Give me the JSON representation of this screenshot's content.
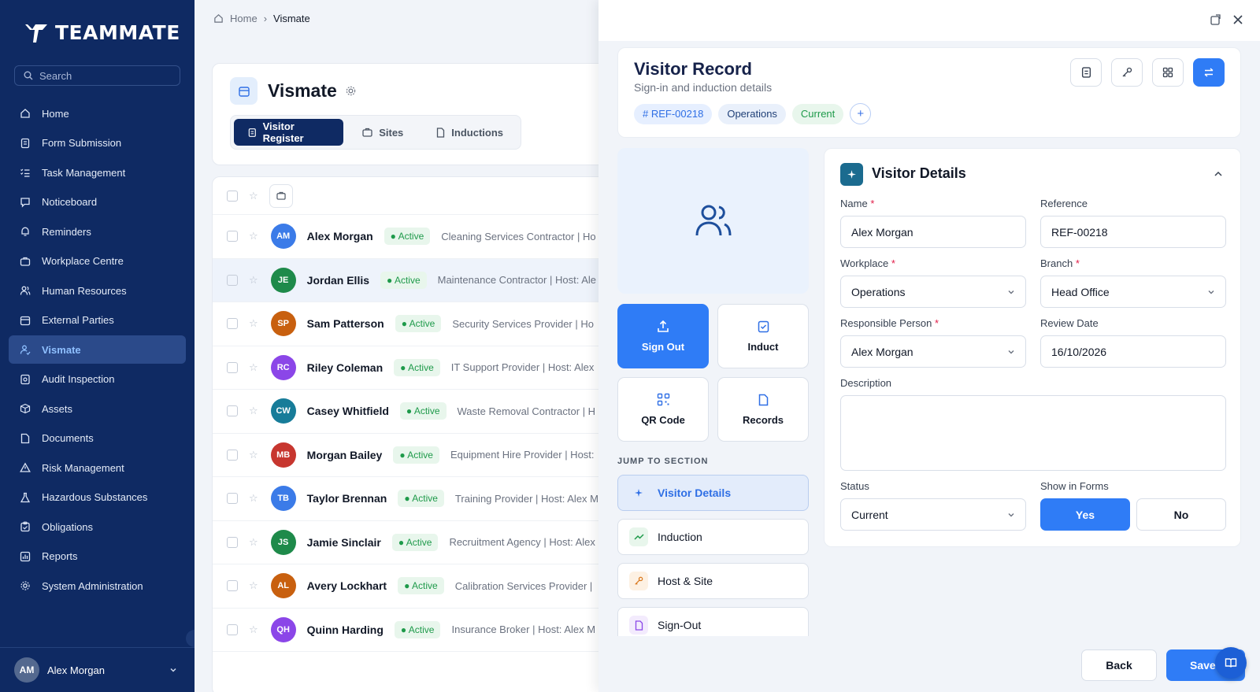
{
  "app": {
    "brand": "TEAMMATE",
    "search_placeholder": "Search"
  },
  "sidebar": {
    "items": [
      {
        "label": "Home",
        "icon": "home-icon"
      },
      {
        "label": "Form Submission",
        "icon": "form-icon"
      },
      {
        "label": "Task Management",
        "icon": "task-list-icon"
      },
      {
        "label": "Noticeboard",
        "icon": "noticeboard-icon"
      },
      {
        "label": "Reminders",
        "icon": "bell-icon"
      },
      {
        "label": "Workplace Centre",
        "icon": "briefcase-icon"
      },
      {
        "label": "Human Resources",
        "icon": "people-icon"
      },
      {
        "label": "External Parties",
        "icon": "calendar-icon"
      },
      {
        "label": "Vismate",
        "icon": "user-check-icon"
      },
      {
        "label": "Audit Inspection",
        "icon": "audit-icon"
      },
      {
        "label": "Assets",
        "icon": "box-icon"
      },
      {
        "label": "Documents",
        "icon": "document-icon"
      },
      {
        "label": "Risk Management",
        "icon": "warning-icon"
      },
      {
        "label": "Hazardous Substances",
        "icon": "flask-icon"
      },
      {
        "label": "Obligations",
        "icon": "clipboard-icon"
      },
      {
        "label": "Reports",
        "icon": "chart-icon"
      },
      {
        "label": "System Administration",
        "icon": "gear-icon"
      }
    ],
    "active_index": 8,
    "user": {
      "initials": "AM",
      "name": "Alex Morgan"
    }
  },
  "breadcrumb": {
    "home": "Home",
    "current": "Vismate"
  },
  "page": {
    "title": "Vismate",
    "tabs": [
      {
        "label": "Visitor Register",
        "active": true
      },
      {
        "label": "Sites",
        "active": false
      },
      {
        "label": "Inductions",
        "active": false
      }
    ]
  },
  "visitors": [
    {
      "initials": "AM",
      "name": "Alex Morgan",
      "status": "Active",
      "desc": "Cleaning Services Contractor | Ho",
      "color": "#3b7be8"
    },
    {
      "initials": "JE",
      "name": "Jordan Ellis",
      "status": "Active",
      "desc": "Maintenance Contractor | Host: Ale",
      "color": "#1e8a4a"
    },
    {
      "initials": "SP",
      "name": "Sam Patterson",
      "status": "Active",
      "desc": "Security Services Provider | Ho",
      "color": "#c8600f"
    },
    {
      "initials": "RC",
      "name": "Riley Coleman",
      "status": "Active",
      "desc": "IT Support Provider | Host: Alex",
      "color": "#8b46e8"
    },
    {
      "initials": "CW",
      "name": "Casey Whitfield",
      "status": "Active",
      "desc": "Waste Removal Contractor | H",
      "color": "#177c99"
    },
    {
      "initials": "MB",
      "name": "Morgan Bailey",
      "status": "Active",
      "desc": "Equipment Hire Provider | Host:",
      "color": "#c7362f"
    },
    {
      "initials": "TB",
      "name": "Taylor Brennan",
      "status": "Active",
      "desc": "Training Provider | Host: Alex M",
      "color": "#3b7be8"
    },
    {
      "initials": "JS",
      "name": "Jamie Sinclair",
      "status": "Active",
      "desc": "Recruitment Agency | Host: Alex",
      "color": "#1e8a4a"
    },
    {
      "initials": "AL",
      "name": "Avery Lockhart",
      "status": "Active",
      "desc": "Calibration Services Provider |",
      "color": "#c8600f"
    },
    {
      "initials": "QH",
      "name": "Quinn Harding",
      "status": "Active",
      "desc": "Insurance Broker | Host: Alex M",
      "color": "#8b46e8"
    }
  ],
  "record": {
    "title": "Visitor Record",
    "subtitle": "Sign-in and induction details",
    "chips": {
      "ref": "# REF-00218",
      "dept": "Operations",
      "status": "Current"
    },
    "actions": [
      {
        "label": "Sign Out",
        "icon": "upload-icon"
      },
      {
        "label": "Induct",
        "icon": "checklist-icon"
      },
      {
        "label": "QR Code",
        "icon": "qr-code-icon"
      },
      {
        "label": "Records",
        "icon": "document-icon"
      }
    ],
    "jump_label": "JUMP TO SECTION",
    "jump": [
      {
        "label": "Visitor Details",
        "icon": "sparkle-icon"
      },
      {
        "label": "Induction",
        "icon": "trend-icon"
      },
      {
        "label": "Host & Site",
        "icon": "key-icon"
      },
      {
        "label": "Sign-Out",
        "icon": "document-icon"
      }
    ]
  },
  "details": {
    "title": "Visitor Details",
    "fields": {
      "name": {
        "label": "Name",
        "value": "Alex Morgan"
      },
      "reference": {
        "label": "Reference",
        "value": "REF-00218"
      },
      "workplace": {
        "label": "Workplace",
        "value": "Operations"
      },
      "branch": {
        "label": "Branch",
        "value": "Head Office"
      },
      "responsible": {
        "label": "Responsible Person",
        "value": "Alex Morgan"
      },
      "review": {
        "label": "Review Date",
        "value": "16/10/2026"
      },
      "description": {
        "label": "Description",
        "value": ""
      },
      "status": {
        "label": "Status",
        "value": "Current"
      },
      "show_in_forms": {
        "label": "Show in Forms",
        "yes": "Yes",
        "no": "No",
        "selected": "Yes"
      }
    },
    "required_mark": "*"
  },
  "footer": {
    "back": "Back",
    "save": "Save"
  },
  "colors": {
    "sidebar": "#0f2a63",
    "primary": "#2f7cf6",
    "active_green": "#1e9a4a"
  }
}
